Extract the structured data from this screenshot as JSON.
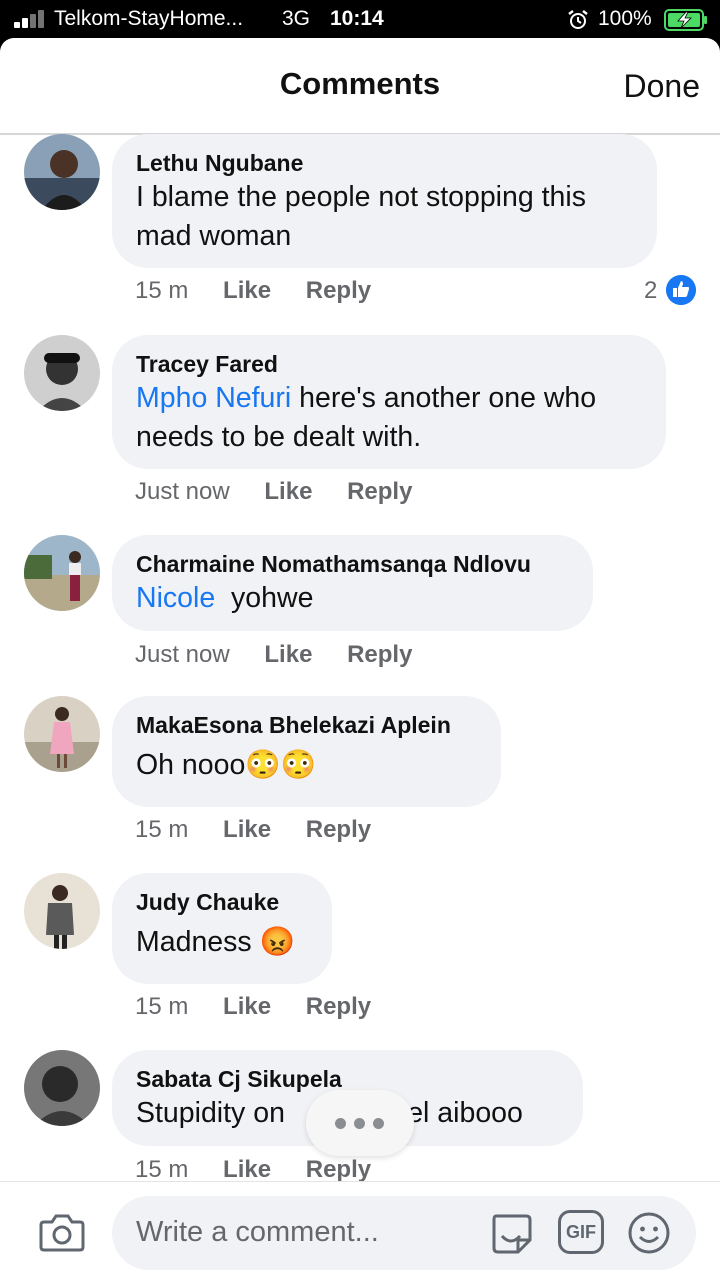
{
  "status_bar": {
    "carrier": "Telkom-StayHome...",
    "network": "3G",
    "time": "10:14",
    "battery": "100%"
  },
  "header": {
    "title": "Comments",
    "done_label": "Done"
  },
  "comments": [
    {
      "author": "Lethu Ngubane",
      "lines": [
        "I blame the people not stopping this",
        "mad woman"
      ],
      "time": "15 m",
      "like": "Like",
      "reply": "Reply",
      "reaction_count": "2"
    },
    {
      "author": "Tracey Fared",
      "mention": "Mpho Nefuri",
      "line1_rest": " here's another one who",
      "line2": "needs to be dealt with.",
      "time": "Just now",
      "like": "Like",
      "reply": "Reply"
    },
    {
      "author": "Charmaine Nomathamsanqa Ndlovu",
      "mention": "Nicole",
      "rest": "  yohwe",
      "time": "Just now",
      "like": "Like",
      "reply": "Reply"
    },
    {
      "author": "MakaEsona Bhelekazi Aplein",
      "text": "Oh nooo😳😳",
      "time": "15 m",
      "like": "Like",
      "reply": "Reply"
    },
    {
      "author": "Judy Chauke",
      "text": "Madness 😡",
      "time": "15 m",
      "like": "Like",
      "reply": "Reply"
    },
    {
      "author": "Sabata Cj Sikupela",
      "text_start": "Stupidity on",
      "text_end": "vel aibooo",
      "time": "15 m",
      "like": "Like",
      "reply": "Reply"
    }
  ],
  "composer": {
    "placeholder": "Write a comment...",
    "gif_label": "GIF"
  },
  "colors": {
    "accent": "#1877f2",
    "bubble": "#f0f2f5",
    "muted_text": "#65676b",
    "battery_green": "#4cd964"
  },
  "icons": [
    "signal-icon",
    "alarm-icon",
    "battery-icon",
    "like-icon",
    "camera-icon",
    "sticker-icon",
    "gif-icon",
    "emoji-icon",
    "typing-indicator"
  ]
}
